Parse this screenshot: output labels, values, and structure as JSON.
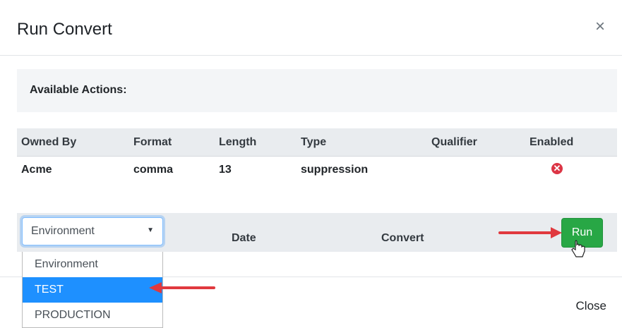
{
  "modal": {
    "title": "Run Convert",
    "close_x": "×",
    "close_button": "Close"
  },
  "actions": {
    "label": "Available Actions:"
  },
  "table": {
    "headers": [
      "Owned By",
      "Format",
      "Length",
      "Type",
      "Qualifier",
      "Enabled"
    ],
    "row": {
      "owned_by": "Acme",
      "format": "comma",
      "length": "13",
      "type": "suppression",
      "qualifier": "",
      "enabled_icon": "✕"
    }
  },
  "run_panel": {
    "select_value": "Environment",
    "date_label": "Date",
    "convert_label": "Convert",
    "run_label": "Run",
    "options": [
      "Environment",
      "TEST",
      "PRODUCTION"
    ],
    "selected_index": 1
  },
  "colors": {
    "run_button": "#28a745",
    "enabled_icon": "#dc3545",
    "selected_option": "#1e90ff",
    "arrow": "#e0393e"
  }
}
